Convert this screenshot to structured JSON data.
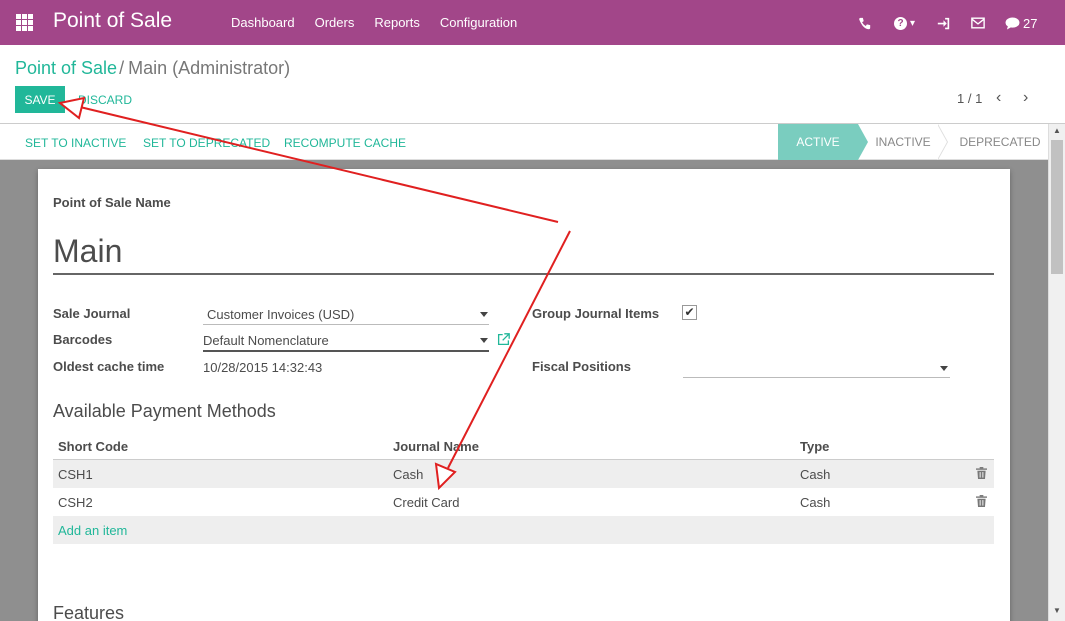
{
  "navbar": {
    "brand": "Point of Sale",
    "menu": [
      "Dashboard",
      "Orders",
      "Reports",
      "Configuration"
    ],
    "help_caret": "▾",
    "chat_count": "27"
  },
  "breadcrumb": {
    "parent": "Point of Sale",
    "separator": "/",
    "current": "Main (Administrator)"
  },
  "buttons": {
    "save": "SAVE",
    "discard": "DISCARD"
  },
  "pager": {
    "value": "1 / 1",
    "prev": "‹",
    "next": "›"
  },
  "statusbar": {
    "actions": [
      "SET TO INACTIVE",
      "SET TO DEPRECATED",
      "RECOMPUTE CACHE"
    ],
    "stages": [
      "ACTIVE",
      "INACTIVE",
      "DEPRECATED"
    ],
    "active_stage": "ACTIVE"
  },
  "form": {
    "name_label": "Point of Sale Name",
    "name_value": "Main",
    "sale_journal_label": "Sale Journal",
    "sale_journal_value": "Customer Invoices (USD)",
    "barcodes_label": "Barcodes",
    "barcodes_value": "Default Nomenclature",
    "cache_time_label": "Oldest cache time",
    "cache_time_value": "10/28/2015 14:32:43",
    "group_journal_label": "Group Journal Items",
    "group_journal_checked": true,
    "fiscal_positions_label": "Fiscal Positions",
    "fiscal_positions_value": ""
  },
  "payment_methods": {
    "title": "Available Payment Methods",
    "columns": [
      "Short Code",
      "Journal Name",
      "Type"
    ],
    "rows": [
      {
        "code": "CSH1",
        "journal": "Cash",
        "type": "Cash"
      },
      {
        "code": "CSH2",
        "journal": "Credit Card",
        "type": "Cash"
      }
    ],
    "add_item": "Add an item"
  },
  "features_title": "Features",
  "colors": {
    "navbar": "#a24689",
    "accent": "#21b799",
    "annotation": "#e02020"
  }
}
